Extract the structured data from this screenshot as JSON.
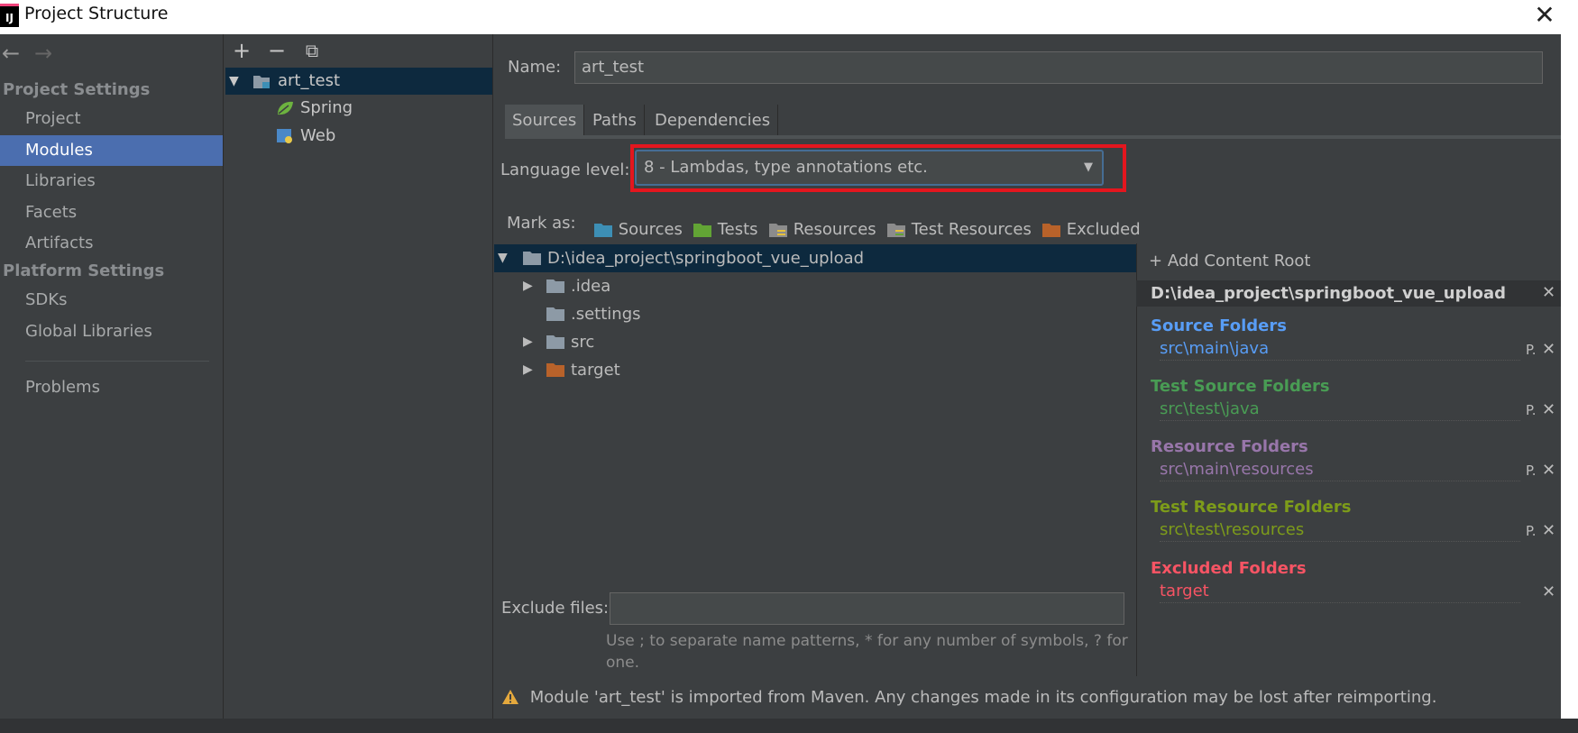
{
  "window": {
    "title": "Project Structure",
    "app_icon": "IJ",
    "close_glyph": "✕"
  },
  "nav": {
    "back": "←",
    "forward": "→"
  },
  "sidebar": {
    "project_settings_header": "Project Settings",
    "platform_settings_header": "Platform Settings",
    "items": [
      {
        "label": "Project"
      },
      {
        "label": "Modules",
        "selected": true
      },
      {
        "label": "Libraries"
      },
      {
        "label": "Facets"
      },
      {
        "label": "Artifacts"
      },
      {
        "label": "SDKs"
      },
      {
        "label": "Global Libraries"
      },
      {
        "label": "Problems"
      }
    ]
  },
  "module_tree": {
    "toolbar": {
      "add": "+",
      "remove": "−",
      "copy": "⧉"
    },
    "module": "art_test",
    "children": [
      "Spring",
      "Web"
    ]
  },
  "module": {
    "name_label": "Name:",
    "name_value": "art_test",
    "tabs": [
      "Sources",
      "Paths",
      "Dependencies"
    ],
    "active_tab": "Sources",
    "language_level_label": "Language level:",
    "language_level_value": "8 - Lambdas, type annotations etc.",
    "mark_as_label": "Mark as:",
    "mark_as": [
      "Sources",
      "Tests",
      "Resources",
      "Test Resources",
      "Excluded"
    ],
    "mark_as_colors": [
      "#3d8fb5",
      "#62a435",
      "#8c8c8c",
      "#8c8c8c",
      "#b8622a"
    ],
    "content_tree": {
      "root": "D:\\idea_project\\springboot_vue_upload",
      "children": [
        ".idea",
        ".settings",
        "src",
        "target"
      ]
    },
    "exclude_files_label": "Exclude files:",
    "exclude_files_value": "",
    "exclude_hint_1": "Use ; to separate name patterns, * for any number of symbols, ? for",
    "exclude_hint_2": "one.",
    "warning": "Module 'art_test' is imported from Maven. Any changes made in its configuration may be lost after reimporting."
  },
  "content_root_panel": {
    "add_label": "Add Content Root",
    "root_path": "D:\\idea_project\\springboot_vue_upload",
    "sections": [
      {
        "title": "Source Folders",
        "path": "src\\main\\java",
        "color": "#589df6"
      },
      {
        "title": "Test Source Folders",
        "path": "src\\test\\java",
        "color": "#499c54"
      },
      {
        "title": "Resource Folders",
        "path": "src\\main\\resources",
        "color": "#9876aa"
      },
      {
        "title": "Test Resource Folders",
        "path": "src\\test\\resources",
        "color": "#7d9c1a"
      },
      {
        "title": "Excluded Folders",
        "path": "target",
        "color": "#f75464"
      }
    ]
  }
}
